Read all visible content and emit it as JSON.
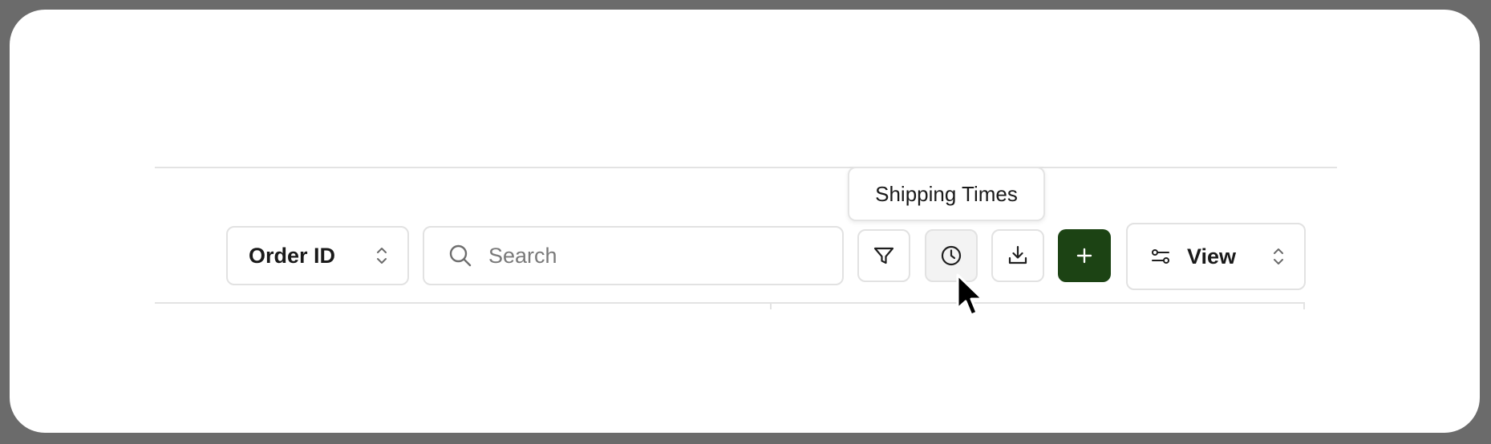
{
  "toolbar": {
    "field_select": {
      "label": "Order ID",
      "icon": "chevron-up-down-icon"
    },
    "search": {
      "placeholder": "Search",
      "value": "",
      "icon": "search-icon"
    },
    "buttons": [
      {
        "name": "filter",
        "icon": "filter-icon"
      },
      {
        "name": "shipping-times",
        "icon": "clock-icon",
        "tooltip": "Shipping Times",
        "hovered": true
      },
      {
        "name": "download",
        "icon": "download-icon"
      },
      {
        "name": "add",
        "icon": "plus-icon"
      }
    ],
    "view_select": {
      "label": "View",
      "icon": "sliders-icon"
    }
  },
  "tooltip": {
    "text": "Shipping Times"
  },
  "colors": {
    "accent": "#1c4314",
    "border": "#e2e2e2",
    "hover_bg": "#f3f3f3",
    "frame": "#6b6b6b"
  }
}
